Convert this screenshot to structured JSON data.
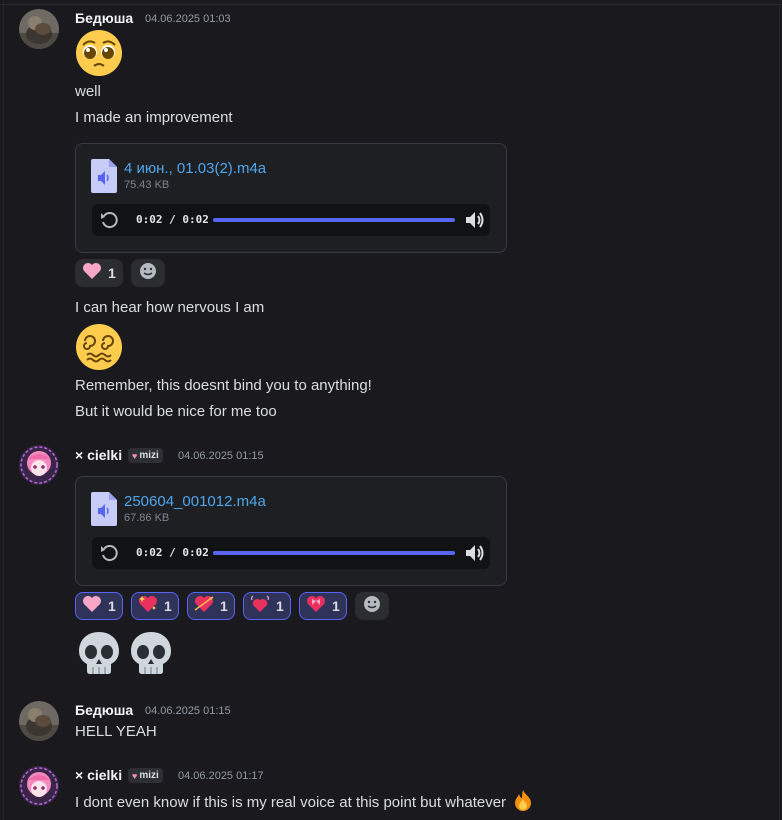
{
  "messages": {
    "m1": {
      "author": "Бедюша",
      "timestamp": "04.06.2025 01:03",
      "emoji": "pleading-face",
      "line1": "well",
      "line2": "I made an improvement",
      "attachment": {
        "name": "4 июн., 01.03(2).m4a",
        "size": "75.43 KB",
        "time": "0:02 / 0:02",
        "progress": 1.0
      },
      "reactions": [
        {
          "emoji": "pink-heart",
          "count": "1"
        }
      ],
      "line3": "I can hear how nervous I am",
      "emoji2": "dizzy-face",
      "line4": "Remember, this doesnt bind you to anything!",
      "line5": "But it would be nice for me too"
    },
    "m2": {
      "author": "× cielki",
      "badge": "mizi",
      "timestamp": "04.06.2025 01:15",
      "attachment": {
        "name": "250604_001012.m4a",
        "size": "67.86 KB",
        "time": "0:02 / 0:02",
        "progress": 1.0
      },
      "reactions": [
        {
          "emoji": "pink-heart",
          "count": "1"
        },
        {
          "emoji": "sparkling-heart",
          "count": "1"
        },
        {
          "emoji": "heart-with-arrow",
          "count": "1"
        },
        {
          "emoji": "growing-heart",
          "count": "1"
        },
        {
          "emoji": "heart-with-ribbon",
          "count": "1"
        }
      ],
      "emoji_pair": [
        "skull",
        "skull"
      ]
    },
    "m3": {
      "author": "Бедюша",
      "timestamp": "04.06.2025 01:15",
      "text": "HELL YEAH"
    },
    "m4": {
      "author": "× cielki",
      "badge": "mizi",
      "timestamp": "04.06.2025 01:17",
      "text": "I dont even know if this is my real voice at this point but whatever",
      "trailing_emoji": "fire"
    }
  },
  "colors": {
    "background": "#1a1a1e",
    "link": "#4ea6ef",
    "accent": "#5865f2",
    "reaction_selected_bg": "#2f3259"
  }
}
